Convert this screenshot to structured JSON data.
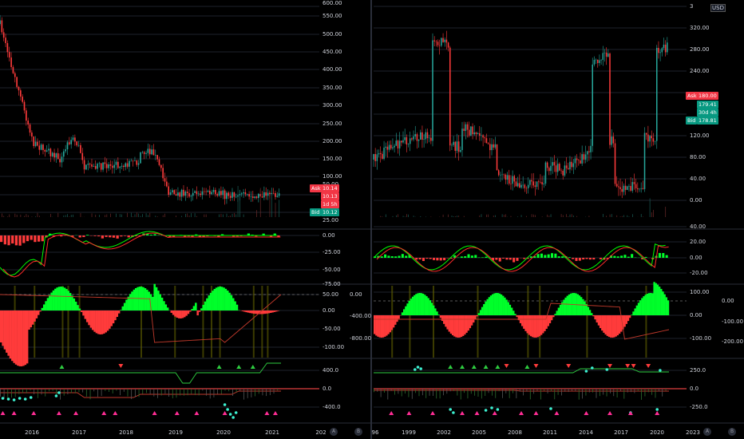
{
  "colors": {
    "up": "#26a69a",
    "up_bright": "#00ff2a",
    "down": "#ff3b3b",
    "grid": "#1e222d",
    "axis_text": "#d1d4dc",
    "signal": "#ff2a2a",
    "macd": "#00ff00",
    "yellow": "#6b6b00",
    "teal": "#3cf0d0",
    "magenta": "#ff2d95"
  },
  "left": {
    "xaxis": [
      "2016",
      "2017",
      "2018",
      "2019",
      "2020",
      "2021",
      "202"
    ],
    "price_ticks": [
      "500.00",
      "450.00",
      "400.00",
      "350.00",
      "300.00",
      "250.00",
      "200.00",
      "150.00",
      "100.00",
      "50.00",
      "25.00"
    ],
    "price_top_partial": [
      "600.00",
      "550.00"
    ],
    "macd_ticks": [
      "0.00",
      "-25.00",
      "-50.00",
      "-75.00"
    ],
    "osc_ticks": [
      "50.00",
      "0.00",
      "-50.00",
      "-100.00"
    ],
    "osc_ticks_mid": [
      "0.00",
      "-400.00",
      "-800.00"
    ],
    "ind3_ticks": [
      "400.0",
      "0.0",
      "-400.0"
    ],
    "ask_label": "Ask",
    "ask_value": "10.14",
    "last_value": "10.13",
    "countdown": "1d 5h",
    "bid_label": "Bid",
    "bid_value": "10.12",
    "scale_mode": "A",
    "log_mode": "B"
  },
  "right": {
    "xaxis": [
      "96",
      "1999",
      "2002",
      "2005",
      "2008",
      "2011",
      "2014",
      "2017",
      "2020",
      "2023"
    ],
    "currency": "USD",
    "top_tick_partial": "3",
    "price_ticks": [
      "320.00",
      "280.00",
      "240.00",
      "120.00",
      "80.00",
      "40.00",
      "0.00"
    ],
    "macd_ticks": [
      "40.00",
      "20.00",
      "0.00",
      "-20.00"
    ],
    "osc_ticks": [
      "100.00",
      "0.00",
      "-100.00"
    ],
    "osc_ticks_far": [
      "0.00",
      "-100.00",
      "-200.00"
    ],
    "ind3_ticks": [
      "250.0",
      "0.0",
      "-250.0"
    ],
    "ask_label": "Ask",
    "ask_value": "180.00",
    "last_value": "179.41",
    "countdown": "30d 4h",
    "bid_label": "Bid",
    "bid_value": "178.81",
    "scale_mode": "A",
    "log_mode": "B"
  }
}
